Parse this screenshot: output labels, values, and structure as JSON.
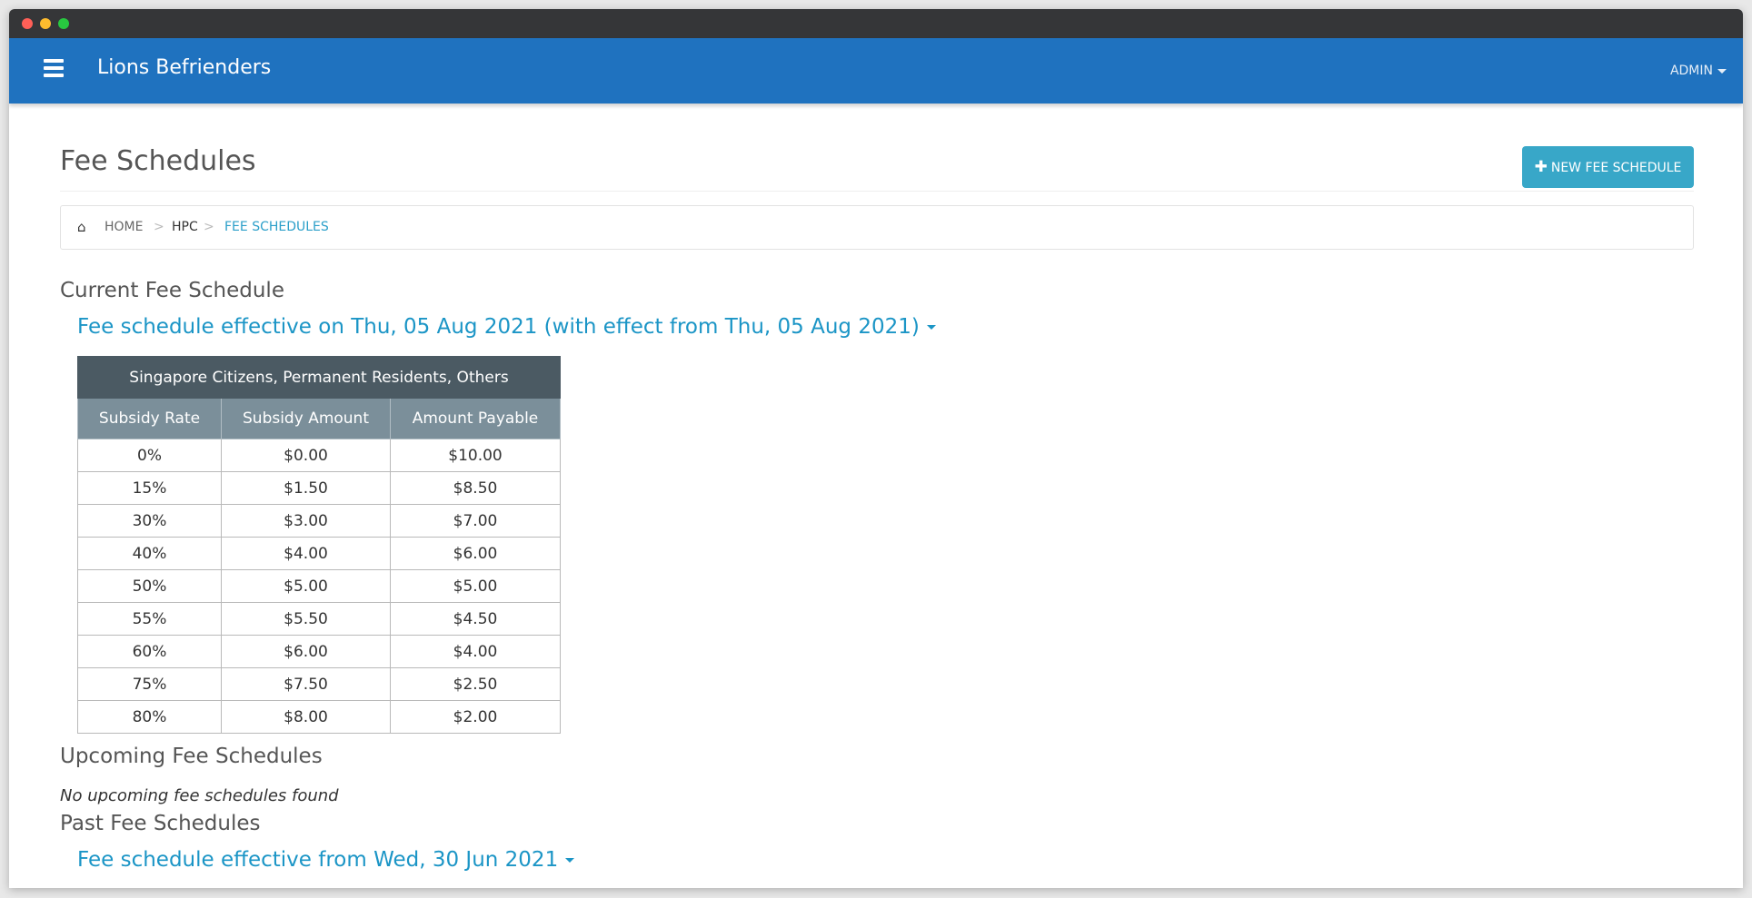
{
  "app": {
    "brand": "Lions Befrienders",
    "user_menu": "ADMIN"
  },
  "page": {
    "title": "Fee Schedules",
    "new_button": "NEW FEE SCHEDULE"
  },
  "breadcrumb": {
    "home": "HOME",
    "separator": ">",
    "hpc": "HPC",
    "current": "FEE SCHEDULES"
  },
  "current": {
    "heading": "Current Fee Schedule",
    "schedule_link": "Fee schedule effective on Thu, 05 Aug 2021 (with effect from Thu, 05 Aug 2021)",
    "table": {
      "group_header": "Singapore Citizens, Permanent Residents, Others",
      "columns": [
        "Subsidy Rate",
        "Subsidy Amount",
        "Amount Payable"
      ],
      "rows": [
        [
          "0%",
          "$0.00",
          "$10.00"
        ],
        [
          "15%",
          "$1.50",
          "$8.50"
        ],
        [
          "30%",
          "$3.00",
          "$7.00"
        ],
        [
          "40%",
          "$4.00",
          "$6.00"
        ],
        [
          "50%",
          "$5.00",
          "$5.00"
        ],
        [
          "55%",
          "$5.50",
          "$4.50"
        ],
        [
          "60%",
          "$6.00",
          "$4.00"
        ],
        [
          "75%",
          "$7.50",
          "$2.50"
        ],
        [
          "80%",
          "$8.00",
          "$2.00"
        ]
      ]
    }
  },
  "upcoming": {
    "heading": "Upcoming Fee Schedules",
    "empty_text": "No upcoming fee schedules found"
  },
  "past": {
    "heading": "Past Fee Schedules",
    "schedule_link": "Fee schedule effective from Wed, 30 Jun 2021"
  },
  "colors": {
    "navbar": "#1f72bf",
    "primary_button": "#38a7c8",
    "link": "#1b95c6",
    "table_group_header": "#4b5a63",
    "table_column_header": "#7b8f9a"
  },
  "icons": {
    "menu": "hamburger-menu-icon",
    "home": "home-icon",
    "plus": "plus-icon",
    "caret": "caret-down-icon"
  }
}
